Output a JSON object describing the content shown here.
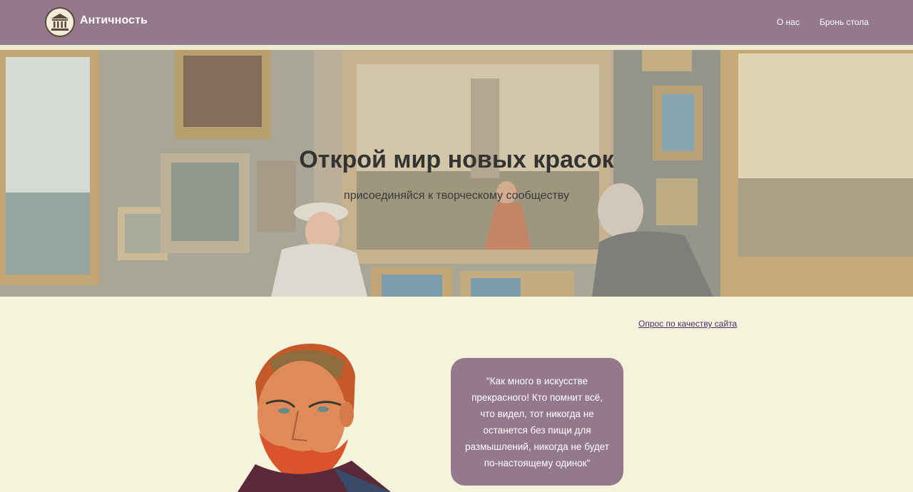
{
  "header": {
    "brand": "Античность",
    "logo_icon": "museum-building-icon",
    "nav": [
      {
        "label": "О нас"
      },
      {
        "label": "Бронь стола"
      }
    ]
  },
  "hero": {
    "title": "Открой мир новых красок",
    "subtitle": "присоединяйся к творческому сообществу"
  },
  "main": {
    "survey_link": "Опрос по качеству сайта",
    "quote": "\"Как много в искусстве прекрасного! Кто помнит всё, что видел, тот никогда не останется без пищи для размышлений, никогда не будет по-настоящему одинок\""
  },
  "colors": {
    "header_bg": "#94788e",
    "page_bg": "#f5f3dc",
    "quote_bg": "#94788e",
    "link": "#4a2d6a"
  }
}
